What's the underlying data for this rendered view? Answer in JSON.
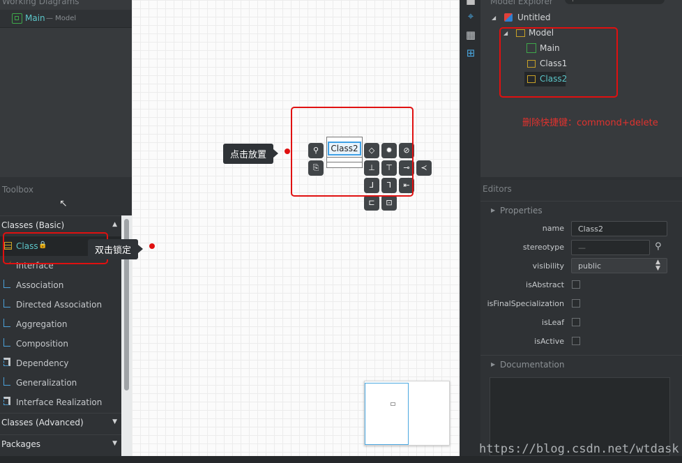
{
  "working_diagrams": {
    "header": "Working Diagrams",
    "items": [
      {
        "name": "Main",
        "sub": "— Model"
      }
    ]
  },
  "toolbox": {
    "header": "Toolbox",
    "groups": [
      {
        "label": "Classes (Basic)"
      },
      {
        "label": "Classes (Advanced)"
      },
      {
        "label": "Packages"
      }
    ],
    "items": [
      {
        "label": "Class"
      },
      {
        "label": "Interface"
      },
      {
        "label": "Association"
      },
      {
        "label": "Directed Association"
      },
      {
        "label": "Aggregation"
      },
      {
        "label": "Composition"
      },
      {
        "label": "Dependency"
      },
      {
        "label": "Generalization"
      },
      {
        "label": "Interface Realization"
      }
    ]
  },
  "annotations": {
    "place_tip": "点击放置",
    "lock_tip": "双击锁定",
    "delete_note": "删除快捷键：commond+delete"
  },
  "diagram": {
    "class_name": "Class2"
  },
  "explorer": {
    "header": "Model Explorer",
    "items": [
      {
        "label": "Untitled"
      },
      {
        "label": "Model"
      },
      {
        "label": "Main"
      },
      {
        "label": "Class1"
      },
      {
        "label": "Class2"
      }
    ]
  },
  "editors": {
    "header": "Editors",
    "properties_label": "Properties",
    "documentation_label": "Documentation",
    "fields": {
      "name": {
        "label": "name",
        "value": "Class2"
      },
      "stereotype": {
        "label": "stereotype",
        "value": "—"
      },
      "visibility": {
        "label": "visibility",
        "value": "public"
      },
      "isAbstract": {
        "label": "isAbstract"
      },
      "isFinalSpecialization": {
        "label": "isFinalSpecialization"
      },
      "isLeaf": {
        "label": "isLeaf"
      },
      "isActive": {
        "label": "isActive"
      }
    }
  },
  "watermark": "https://blog.csdn.net/wtdask",
  "colors": {
    "accent": "#5cc6c9",
    "highlight": "#e01010",
    "selection": "#3ea0e6"
  }
}
